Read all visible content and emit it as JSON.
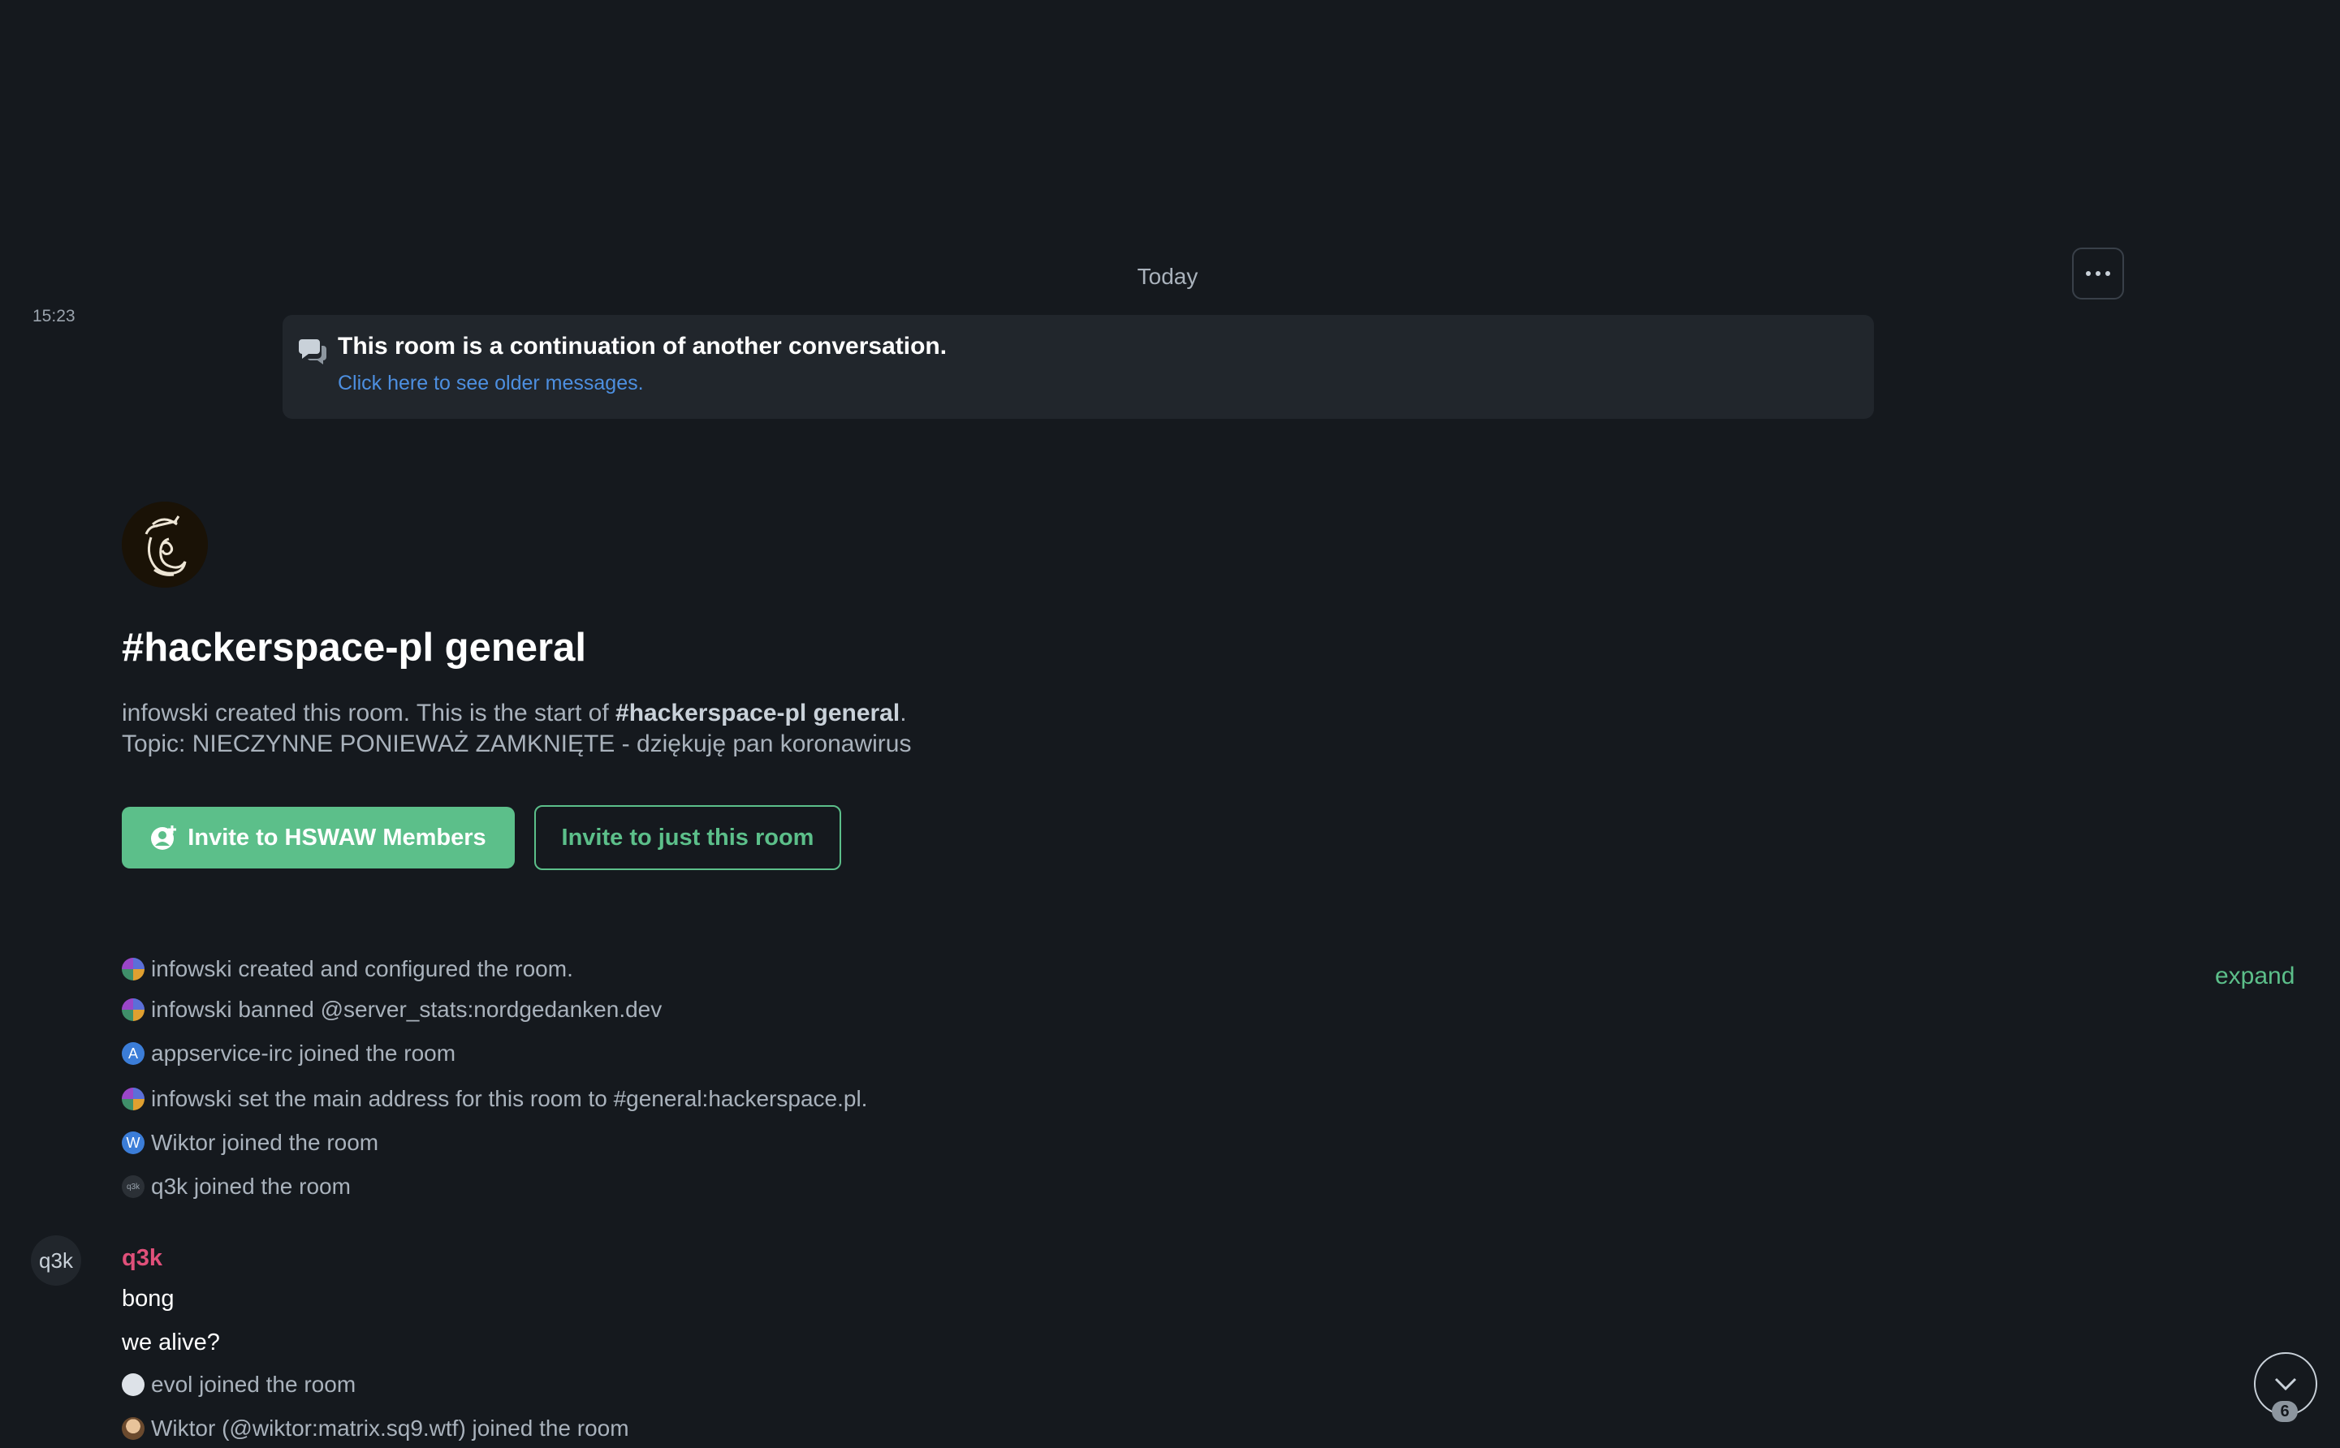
{
  "timeline": {
    "date_separator": "Today",
    "timestamp": "15:23",
    "more_icon": "ellipsis-icon"
  },
  "continuation": {
    "icon": "chat-bubbles-icon",
    "title": "This room is a continuation of another conversation.",
    "link": "Click here to see older messages."
  },
  "room": {
    "name": "#hackerspace-pl general",
    "intro_prefix": "infowski created this room. This is the start of ",
    "intro_room": "#hackerspace-pl general",
    "intro_suffix": ".",
    "topic": "Topic: NIECZYNNE PONIEWAŻ ZAMKNIĘTE - dziękuję pan koronawirus"
  },
  "actions": {
    "invite_space": "Invite to HSWAW Members",
    "invite_room": "Invite to just this room"
  },
  "events": [
    {
      "avatar": "",
      "text": "infowski created and configured the room."
    },
    {
      "avatar": "",
      "text": "infowski banned @server_stats:nordgedanken.dev"
    },
    {
      "avatar": "A",
      "text": "appservice-irc joined the room"
    },
    {
      "avatar": "",
      "text": "infowski set the main address for this room to #general:hackerspace.pl."
    },
    {
      "avatar": "W",
      "text": "Wiktor joined the room"
    },
    {
      "avatar": "q3k",
      "text": "q3k joined the room"
    }
  ],
  "expand_label": "expand",
  "message": {
    "avatar": "q3k",
    "sender": "q3k",
    "sender_color": "#e0507a",
    "lines": [
      "bong",
      "we alive?"
    ]
  },
  "later_events": [
    {
      "text": "evol joined the room"
    },
    {
      "text": "Wiktor (@wiktor:matrix.sq9.wtf) joined the room"
    }
  ],
  "jump_to_bottom": {
    "icon": "chevron-down-icon",
    "unread": "6"
  },
  "colors": {
    "background": "#15191e",
    "accent": "#5cbf8a",
    "link": "#4d8fe0"
  }
}
